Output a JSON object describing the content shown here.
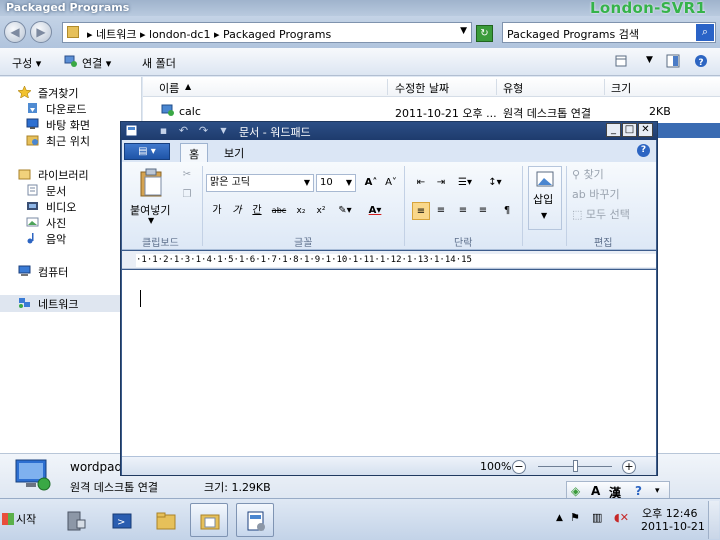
{
  "explorer": {
    "title": "Packaged Programs",
    "watermark": "London-SVR1",
    "breadcrumbs": "▸ 네트워크 ▸ london-dc1 ▸ Packaged Programs",
    "search_placeholder": "Packaged Programs 검색",
    "commands": {
      "organize": "구성 ▾",
      "connect": "연결 ▾",
      "new_folder": "새 폴더"
    },
    "nav": {
      "favorites": "즐겨찾기",
      "downloads": "다운로드",
      "desktop": "바탕 화면",
      "recent": "최근 위치",
      "libraries": "라이브러리",
      "documents": "문서",
      "videos": "비디오",
      "pictures": "사진",
      "music": "음악",
      "computer": "컴퓨터",
      "network": "네트워크"
    },
    "columns": {
      "name": "이름",
      "modified": "수정한 날짜",
      "type": "유형",
      "size": "크기"
    },
    "rows": [
      {
        "name": "calc",
        "modified": "2011-10-21 오후 ...",
        "type": "원격 데스크톱 연결",
        "size": "2KB"
      }
    ],
    "details": {
      "name": "wordpad",
      "type": "원격 데스크톱 연결",
      "size": "크기: 1.29KB"
    }
  },
  "wordpad": {
    "title": "문서 - 워드패드",
    "tabs": {
      "home": "홈",
      "view": "보기"
    },
    "clipboard": {
      "paste": "붙여넣기",
      "group": "클립보드"
    },
    "font": {
      "name": "맑은 고딕",
      "size": "10",
      "group": "글꼴"
    },
    "paragraph": {
      "group": "단락"
    },
    "insert": {
      "label": "삽입"
    },
    "editing": {
      "find": "찾기",
      "replace": "바꾸기",
      "select_all": "모두 선택",
      "group": "편집"
    },
    "ruler": "·1·1·2·1·3·1·4·1·5·1·6·1·7·1·8·1·9·1·10·1·11·1·12·1·13·1·14·15",
    "zoom": "100%"
  },
  "taskbar": {
    "start": "시작",
    "time": "오후 12:46",
    "date": "2011-10-21"
  }
}
